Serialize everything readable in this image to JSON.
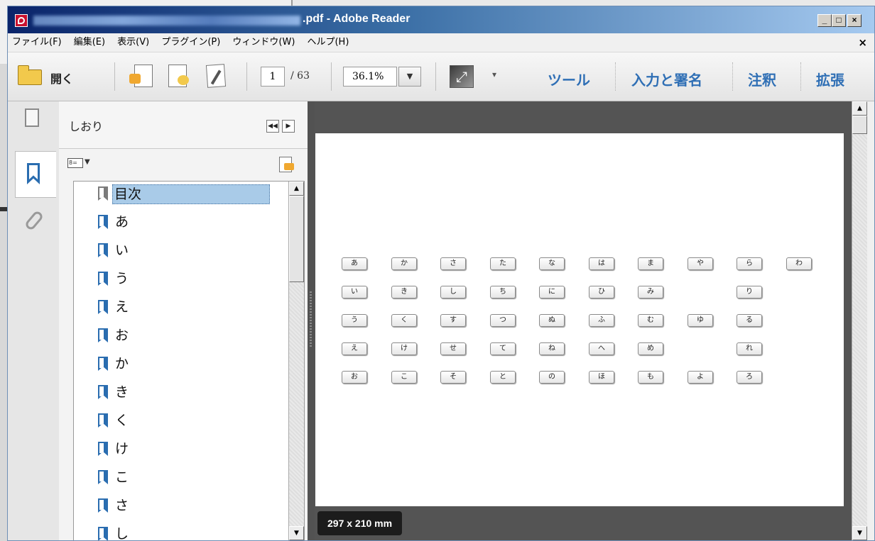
{
  "window": {
    "title": ".pdf - Adobe Reader",
    "controls": {
      "minimize": "_",
      "maximize": "□",
      "close": "×"
    }
  },
  "menu": {
    "items": [
      "ファイル(F)",
      "編集(E)",
      "表示(V)",
      "プラグイン(P)",
      "ウィンドウ(W)",
      "ヘルプ(H)"
    ],
    "close": "×"
  },
  "toolbar": {
    "open_label": "開く",
    "page_current": "1",
    "page_total": "/ 63",
    "zoom": "36.1%",
    "zoom_drop": "▼",
    "more": "▾",
    "tools_label": "ツール",
    "sign_label": "入力と署名",
    "comment_label": "注釈",
    "extend_label": "拡張"
  },
  "sidebar": {
    "panel_title": "しおり",
    "bookmarks": [
      "目次",
      "あ",
      "い",
      "う",
      "え",
      "お",
      "か",
      "き",
      "く",
      "け",
      "こ",
      "さ",
      "し"
    ],
    "selected_index": 0
  },
  "document": {
    "kana_grid": [
      [
        "あ",
        "か",
        "さ",
        "た",
        "な",
        "は",
        "ま",
        "や",
        "ら",
        "わ"
      ],
      [
        "い",
        "き",
        "し",
        "ち",
        "に",
        "ひ",
        "み",
        "",
        "り",
        ""
      ],
      [
        "う",
        "く",
        "す",
        "つ",
        "ぬ",
        "ふ",
        "む",
        "ゆ",
        "る",
        ""
      ],
      [
        "え",
        "け",
        "せ",
        "て",
        "ね",
        "へ",
        "め",
        "",
        "れ",
        ""
      ],
      [
        "お",
        "こ",
        "そ",
        "と",
        "の",
        "ほ",
        "も",
        "よ",
        "ろ",
        ""
      ]
    ],
    "page_size": "297 x 210 mm"
  },
  "scroll": {
    "up": "▲",
    "down": "▼"
  },
  "nav_btn": {
    "first": "◀◀",
    "next": "▶"
  },
  "colors": {
    "accent_link": "#2f6fb5",
    "selection": "#a9cbe8",
    "doc_bg": "#545454"
  }
}
